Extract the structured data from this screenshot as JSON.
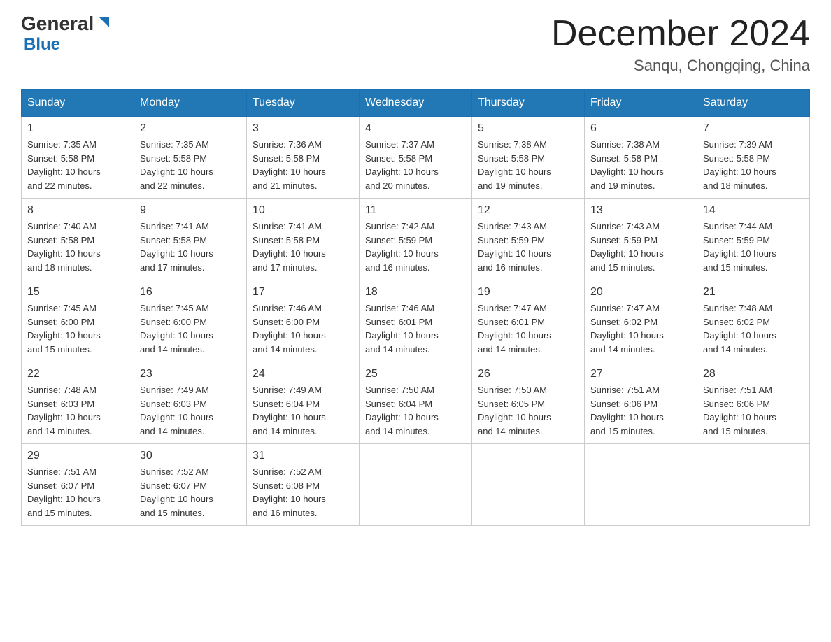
{
  "header": {
    "logo_general": "General",
    "logo_blue": "Blue",
    "title": "December 2024",
    "location": "Sanqu, Chongqing, China"
  },
  "days_of_week": [
    "Sunday",
    "Monday",
    "Tuesday",
    "Wednesday",
    "Thursday",
    "Friday",
    "Saturday"
  ],
  "weeks": [
    [
      {
        "day": "1",
        "sunrise": "7:35 AM",
        "sunset": "5:58 PM",
        "daylight": "10 hours and 22 minutes."
      },
      {
        "day": "2",
        "sunrise": "7:35 AM",
        "sunset": "5:58 PM",
        "daylight": "10 hours and 22 minutes."
      },
      {
        "day": "3",
        "sunrise": "7:36 AM",
        "sunset": "5:58 PM",
        "daylight": "10 hours and 21 minutes."
      },
      {
        "day": "4",
        "sunrise": "7:37 AM",
        "sunset": "5:58 PM",
        "daylight": "10 hours and 20 minutes."
      },
      {
        "day": "5",
        "sunrise": "7:38 AM",
        "sunset": "5:58 PM",
        "daylight": "10 hours and 19 minutes."
      },
      {
        "day": "6",
        "sunrise": "7:38 AM",
        "sunset": "5:58 PM",
        "daylight": "10 hours and 19 minutes."
      },
      {
        "day": "7",
        "sunrise": "7:39 AM",
        "sunset": "5:58 PM",
        "daylight": "10 hours and 18 minutes."
      }
    ],
    [
      {
        "day": "8",
        "sunrise": "7:40 AM",
        "sunset": "5:58 PM",
        "daylight": "10 hours and 18 minutes."
      },
      {
        "day": "9",
        "sunrise": "7:41 AM",
        "sunset": "5:58 PM",
        "daylight": "10 hours and 17 minutes."
      },
      {
        "day": "10",
        "sunrise": "7:41 AM",
        "sunset": "5:58 PM",
        "daylight": "10 hours and 17 minutes."
      },
      {
        "day": "11",
        "sunrise": "7:42 AM",
        "sunset": "5:59 PM",
        "daylight": "10 hours and 16 minutes."
      },
      {
        "day": "12",
        "sunrise": "7:43 AM",
        "sunset": "5:59 PM",
        "daylight": "10 hours and 16 minutes."
      },
      {
        "day": "13",
        "sunrise": "7:43 AM",
        "sunset": "5:59 PM",
        "daylight": "10 hours and 15 minutes."
      },
      {
        "day": "14",
        "sunrise": "7:44 AM",
        "sunset": "5:59 PM",
        "daylight": "10 hours and 15 minutes."
      }
    ],
    [
      {
        "day": "15",
        "sunrise": "7:45 AM",
        "sunset": "6:00 PM",
        "daylight": "10 hours and 15 minutes."
      },
      {
        "day": "16",
        "sunrise": "7:45 AM",
        "sunset": "6:00 PM",
        "daylight": "10 hours and 14 minutes."
      },
      {
        "day": "17",
        "sunrise": "7:46 AM",
        "sunset": "6:00 PM",
        "daylight": "10 hours and 14 minutes."
      },
      {
        "day": "18",
        "sunrise": "7:46 AM",
        "sunset": "6:01 PM",
        "daylight": "10 hours and 14 minutes."
      },
      {
        "day": "19",
        "sunrise": "7:47 AM",
        "sunset": "6:01 PM",
        "daylight": "10 hours and 14 minutes."
      },
      {
        "day": "20",
        "sunrise": "7:47 AM",
        "sunset": "6:02 PM",
        "daylight": "10 hours and 14 minutes."
      },
      {
        "day": "21",
        "sunrise": "7:48 AM",
        "sunset": "6:02 PM",
        "daylight": "10 hours and 14 minutes."
      }
    ],
    [
      {
        "day": "22",
        "sunrise": "7:48 AM",
        "sunset": "6:03 PM",
        "daylight": "10 hours and 14 minutes."
      },
      {
        "day": "23",
        "sunrise": "7:49 AM",
        "sunset": "6:03 PM",
        "daylight": "10 hours and 14 minutes."
      },
      {
        "day": "24",
        "sunrise": "7:49 AM",
        "sunset": "6:04 PM",
        "daylight": "10 hours and 14 minutes."
      },
      {
        "day": "25",
        "sunrise": "7:50 AM",
        "sunset": "6:04 PM",
        "daylight": "10 hours and 14 minutes."
      },
      {
        "day": "26",
        "sunrise": "7:50 AM",
        "sunset": "6:05 PM",
        "daylight": "10 hours and 14 minutes."
      },
      {
        "day": "27",
        "sunrise": "7:51 AM",
        "sunset": "6:06 PM",
        "daylight": "10 hours and 15 minutes."
      },
      {
        "day": "28",
        "sunrise": "7:51 AM",
        "sunset": "6:06 PM",
        "daylight": "10 hours and 15 minutes."
      }
    ],
    [
      {
        "day": "29",
        "sunrise": "7:51 AM",
        "sunset": "6:07 PM",
        "daylight": "10 hours and 15 minutes."
      },
      {
        "day": "30",
        "sunrise": "7:52 AM",
        "sunset": "6:07 PM",
        "daylight": "10 hours and 15 minutes."
      },
      {
        "day": "31",
        "sunrise": "7:52 AM",
        "sunset": "6:08 PM",
        "daylight": "10 hours and 16 minutes."
      },
      null,
      null,
      null,
      null
    ]
  ],
  "labels": {
    "sunrise": "Sunrise:",
    "sunset": "Sunset:",
    "daylight": "Daylight:"
  }
}
